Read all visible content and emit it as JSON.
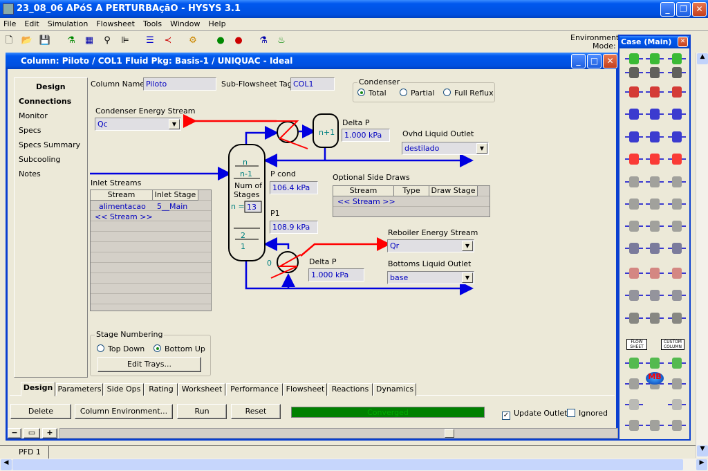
{
  "app": {
    "title": "23_08_06 APóS A PERTURBAçãO - HYSYS 3.1",
    "menu": [
      "File",
      "Edit",
      "Simulation",
      "Flowsheet",
      "Tools",
      "Window",
      "Help"
    ],
    "environment": "Environment: C",
    "mode": "Mode: S"
  },
  "column_window": {
    "title": "Column: Piloto / COL1  Fluid Pkg: Basis-1 / UNIQUAC - Ideal",
    "nav": {
      "header": "Design",
      "items": [
        "Connections",
        "Monitor",
        "Specs",
        "Specs Summary",
        "Subcooling",
        "Notes"
      ],
      "selected": "Connections"
    },
    "column_name_label": "Column Name",
    "column_name": "Piloto",
    "subflowsheet_label": "Sub-Flowsheet Tag",
    "subflowsheet_tag": "COL1",
    "condenser": {
      "label": "Condenser",
      "options": [
        "Total",
        "Partial",
        "Full Reflux"
      ],
      "selected": "Total"
    },
    "condenser_energy_label": "Condenser Energy Stream",
    "condenser_energy": "Qc",
    "inlet": {
      "label": "Inlet Streams",
      "headers": [
        "Stream",
        "Inlet Stage"
      ],
      "rows": [
        [
          "alimentacao",
          "5__Main"
        ],
        [
          "<< Stream >>",
          ""
        ]
      ]
    },
    "diagram": {
      "top_stage": "n",
      "stage_n1": "n-1",
      "num_label1": "Num of",
      "num_label2": "Stages",
      "n_eq": "n =",
      "num_stages": "13",
      "stage2": "2",
      "stage1": "1",
      "condenser_stage": "n+1",
      "reboiler_stage": "0"
    },
    "delta_p_top_label": "Delta P",
    "delta_p_top": "1.000 kPa",
    "ovhd_label": "Ovhd Liquid Outlet",
    "ovhd": "destilado",
    "pcond_label": "P cond",
    "pcond": "106.4 kPa",
    "p1_label": "P1",
    "p1": "108.9 kPa",
    "side_draws": {
      "label": "Optional Side Draws",
      "headers": [
        "Stream",
        "Type",
        "Draw Stage"
      ],
      "rows": [
        [
          "<< Stream >>",
          "",
          ""
        ]
      ]
    },
    "reboiler_energy_label": "Reboiler Energy Stream",
    "reboiler_energy": "Qr",
    "delta_p_bot_label": "Delta P",
    "delta_p_bot": "1.000 kPa",
    "bottoms_label": "Bottoms Liquid Outlet",
    "bottoms": "base",
    "stage_numbering": {
      "label": "Stage Numbering",
      "options": [
        "Top Down",
        "Bottom Up"
      ],
      "selected": "Bottom Up",
      "edit_trays": "Edit Trays..."
    },
    "tabs": [
      "Design",
      "Parameters",
      "Side Ops",
      "Rating",
      "Worksheet",
      "Performance",
      "Flowsheet",
      "Reactions",
      "Dynamics"
    ],
    "active_tab": "Design",
    "buttons": {
      "delete": "Delete",
      "column_env": "Column Environment...",
      "run": "Run",
      "reset": "Reset"
    },
    "status": {
      "text": "Converged",
      "progress": 100,
      "color": "#008000"
    },
    "update_outlets": {
      "label": "Update Outlets",
      "checked": true
    },
    "ignored": {
      "label": "Ignored",
      "checked": false
    }
  },
  "palette": {
    "title": "Case (Main)",
    "flow_sheet": "FLOW SHEET",
    "custom_column": "CUSTOM COLUMN",
    "mb": "MB"
  },
  "pfd_tab": "PFD 1",
  "colors": {
    "stream_material": "#0000e0",
    "stream_energy": "#ff0000",
    "title_blue": "#0054e3"
  }
}
